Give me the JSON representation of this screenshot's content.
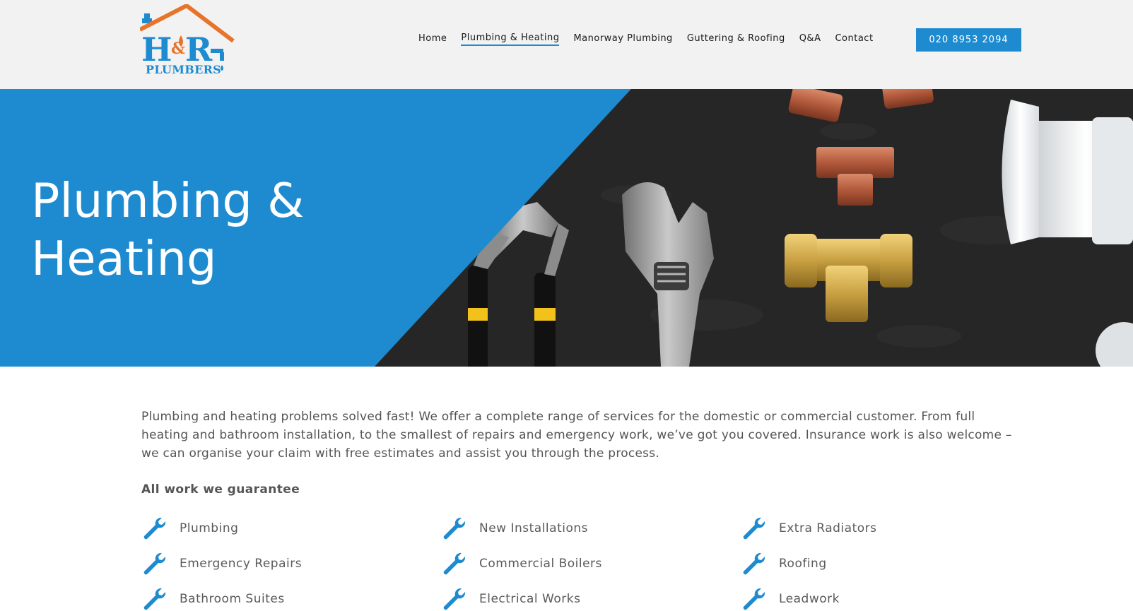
{
  "brand": {
    "logo_letters": "H&R",
    "logo_sub": "PLUMBERS",
    "colors": {
      "primary_blue": "#1e8bd0",
      "logo_orange": "#e8742a",
      "header_bg": "#f2f2f2"
    }
  },
  "nav": {
    "items": [
      {
        "label": "Home",
        "active": false
      },
      {
        "label": "Plumbing & Heating",
        "active": true
      },
      {
        "label": "Manorway Plumbing",
        "active": false
      },
      {
        "label": "Guttering & Roofing",
        "active": false
      },
      {
        "label": "Q&A",
        "active": false
      },
      {
        "label": "Contact",
        "active": false
      }
    ],
    "phone": "020 8953 2094"
  },
  "hero": {
    "title_line1": "Plumbing &",
    "title_line2": "Heating"
  },
  "content": {
    "intro": "Plumbing and heating problems solved fast! We offer a complete range of services for the domestic or commercial customer. From full heating and bathroom installation, to the smallest of repairs and emergency work, we’ve got you covered. Insurance work is also welcome – we can organise your claim with free estimates and assist you through the process.",
    "guarantee_heading": "All work we guarantee",
    "services": [
      {
        "label": "Plumbing",
        "icon": "wrench-icon"
      },
      {
        "label": "New Installations",
        "icon": "wrench-icon"
      },
      {
        "label": "Extra Radiators",
        "icon": "wrench-icon"
      },
      {
        "label": "Emergency Repairs",
        "icon": "wrench-icon"
      },
      {
        "label": "Commercial Boilers",
        "icon": "wrench-icon"
      },
      {
        "label": "Roofing",
        "icon": "wrench-icon"
      },
      {
        "label": "Bathroom Suites",
        "icon": "wrench-icon"
      },
      {
        "label": "Electrical Works",
        "icon": "wrench-icon"
      },
      {
        "label": "Leadwork",
        "icon": "wrench-icon"
      }
    ]
  }
}
